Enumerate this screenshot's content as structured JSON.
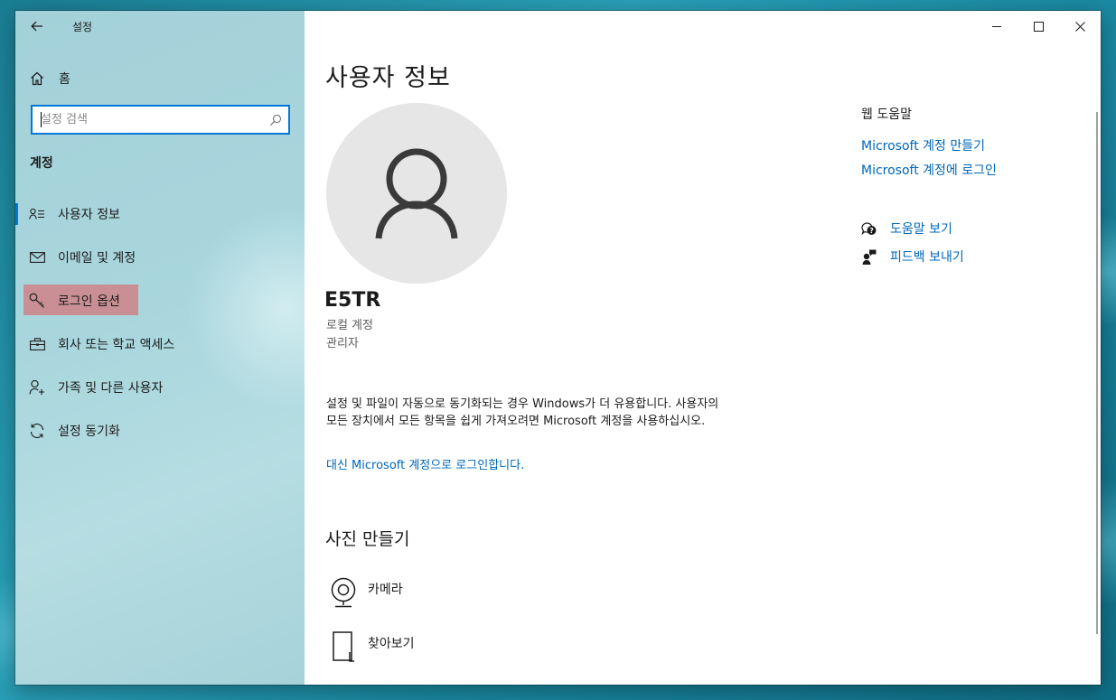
{
  "window": {
    "app_title": "설정"
  },
  "sidebar": {
    "home_label": "홈",
    "search_placeholder": "설정 검색",
    "section_heading": "계정",
    "items": [
      {
        "label": "사용자 정보",
        "icon": "user-info-icon",
        "selected": true
      },
      {
        "label": "이메일 및 계정",
        "icon": "mail-icon"
      },
      {
        "label": "로그인 옵션",
        "icon": "key-icon",
        "highlighted": true
      },
      {
        "label": "회사 또는 학교 액세스",
        "icon": "briefcase-icon"
      },
      {
        "label": "가족 및 다른 사용자",
        "icon": "add-person-icon"
      },
      {
        "label": "설정 동기화",
        "icon": "sync-icon"
      }
    ]
  },
  "main": {
    "page_title": "사용자 정보",
    "user_name": "E5TR",
    "account_type": "로컬 계정",
    "account_role": "관리자",
    "info_text": "설정 및 파일이 자동으로 동기화되는 경우 Windows가 더 유용합니다. 사용자의 모든 장치에서 모든 항목을 쉽게 가져오려면 Microsoft 계정을 사용하십시오.",
    "ms_signin_link": "대신 Microsoft 계정으로 로그인합니다.",
    "photo_section_title": "사진 만들기",
    "photo_options": [
      {
        "label": "카메라",
        "icon": "camera-icon"
      },
      {
        "label": "찾아보기",
        "icon": "browse-icon"
      }
    ]
  },
  "right_panel": {
    "web_help_heading": "웹 도움말",
    "links": [
      "Microsoft 계정 만들기",
      "Microsoft 계정에 로그인"
    ],
    "actions": [
      {
        "label": "도움말 보기",
        "icon": "help-chat-icon"
      },
      {
        "label": "피드백 보내기",
        "icon": "feedback-icon"
      }
    ]
  },
  "colors": {
    "accent": "#0078d7",
    "link": "#0067b8",
    "highlight": "#c98f95",
    "sidebar_bg": "#a9d6dd"
  }
}
